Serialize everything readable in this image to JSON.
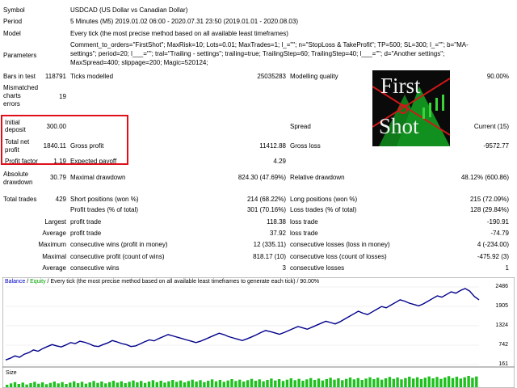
{
  "report": {
    "symbol_label": "Symbol",
    "symbol_value": "USDCAD (US Dollar vs Canadian Dollar)",
    "period_label": "Period",
    "period_value": "5 Minutes (M5) 2019.01.02 06:00 - 2020.07.31 23:50 (2019.01.01 - 2020.08.03)",
    "model_label": "Model",
    "model_value": "Every tick (the most precise method based on all available least timeframes)",
    "parameters_label": "Parameters",
    "parameters_line1": "Comment_to_orders=\"FirstShot\"; MaxRisk=10; Lots=0.01; MaxTrades=1; l_=\"\"; n=\"StopLoss & TakeProfit\"; TP=500; SL=300; l_=\"\"; b=\"MA-",
    "parameters_line2": "settings\"; period=20; l___=\"\"; tral=\"Trailing - settings\"; trailing=true; TrailingStep=60; TrailingStep=40; l___=\"\"; d=\"Another settings\";",
    "parameters_line3": "MaxSpread=400; slippage=200; Magic=520124;",
    "bars_label": "Bars in test",
    "bars_value": "118791",
    "ticks_label": "Ticks modelled",
    "ticks_value": "25035283",
    "quality_label": "Modelling quality",
    "quality_value": "90.00%",
    "mismatched_label_1": "Mismatched",
    "mismatched_label_2": "charts",
    "mismatched_label_3": "errors",
    "mismatched_value": "19",
    "initial_label_1": "Initial",
    "initial_label_2": "deposit",
    "initial_value": "300.00",
    "spread_label": "Spread",
    "spread_value": "Current (15)",
    "net_label_1": "Total net",
    "net_label_2": "profit",
    "net_value": "1840.11",
    "gross_profit_label": "Gross profit",
    "gross_profit_value": "11412.88",
    "gross_loss_label": "Gross loss",
    "gross_loss_value": "-9572.77",
    "pf_label": "Profit factor",
    "pf_value": "1.19",
    "ep_label": "Expected payoff",
    "ep_value": "4.29",
    "abs_dd_label_1": "Absolute",
    "abs_dd_label_2": "drawdown",
    "abs_dd_value": "30.79",
    "max_dd_label": "Maximal drawdown",
    "max_dd_value": "824.30 (47.69%)",
    "rel_dd_label": "Relative drawdown",
    "rel_dd_value": "48.12% (600.86)",
    "total_trades_label": "Total trades",
    "total_trades_value": "429",
    "short_label": "Short positions (won %)",
    "short_value": "214 (68.22%)",
    "long_label": "Long positions (won %)",
    "long_value": "215 (72.09%)",
    "profit_trades_label": "Profit trades (% of total)",
    "profit_trades_value": "301 (70.16%)",
    "loss_trades_label": "Loss trades (% of total)",
    "loss_trades_value": "128 (29.84%)",
    "largest_label": "Largest",
    "largest_profit_label": "profit trade",
    "largest_profit_value": "118.38",
    "largest_loss_label": "loss trade",
    "largest_loss_value": "-190.91",
    "average_label": "Average",
    "average_profit_label": "profit trade",
    "average_profit_value": "37.92",
    "average_loss_label": "loss trade",
    "average_loss_value": "-74.79",
    "maximum_label": "Maximum",
    "max_cons_wins_label": "consecutive wins (profit in money)",
    "max_cons_wins_value": "12 (335.11)",
    "max_cons_losses_label": "consecutive losses (loss in money)",
    "max_cons_losses_value": "4 (-234.00)",
    "maximal_label": "Maximal",
    "maximal_wins_label": "consecutive profit (count of wins)",
    "maximal_wins_value": "818.17 (10)",
    "maximal_losses_label": "consecutive loss (count of losses)",
    "maximal_losses_value": "-475.92 (3)",
    "average2_label": "Average",
    "avg_cons_wins_label": "consecutive wins",
    "avg_cons_wins_value": "3",
    "avg_cons_losses_label": "consecutive losses",
    "avg_cons_losses_value": "1"
  },
  "logo": {
    "line1": "First",
    "line2": "Shot"
  },
  "chart_legend": {
    "balance": "Balance",
    "sep1": " / ",
    "equity": "Equity",
    "rest": " / Every tick (the most precise method based on all available least timeframes to generate each tick) / 90.00%",
    "balance_color": "#0000c8",
    "equity_color": "#00a000"
  },
  "size_label": "Size",
  "colors": {
    "highlight": "#e0101a",
    "balance_line": "#00008b",
    "volume": "#1fc01f"
  },
  "chart_data": {
    "type": "line",
    "title": "",
    "yticks": [
      161,
      742,
      1324,
      1905,
      2486
    ],
    "ylim": [
      161,
      2486
    ],
    "series": [
      {
        "name": "Balance",
        "values": [
          300,
          350,
          420,
          380,
          470,
          520,
          600,
          560,
          640,
          700,
          760,
          720,
          690,
          750,
          820,
          790,
          860,
          830,
          780,
          720,
          700,
          760,
          810,
          880,
          840,
          790,
          760,
          700,
          720,
          780,
          850,
          900,
          870,
          940,
          1000,
          1060,
          1020,
          980,
          940,
          900,
          860,
          820,
          860,
          920,
          980,
          1040,
          1100,
          1060,
          1000,
          960,
          920,
          880,
          930,
          990,
          1050,
          1120,
          1180,
          1150,
          1110,
          1070,
          1120,
          1180,
          1240,
          1300,
          1260,
          1220,
          1280,
          1340,
          1400,
          1460,
          1420,
          1380,
          1440,
          1520,
          1600,
          1680,
          1760,
          1700,
          1660,
          1740,
          1820,
          1900,
          1860,
          1940,
          2020,
          2100,
          2060,
          2000,
          1960,
          1920,
          1980,
          2060,
          2140,
          2220,
          2180,
          2260,
          2340,
          2300,
          2380,
          2440,
          2360,
          2200,
          2100
        ]
      }
    ],
    "volume": {
      "name": "Size",
      "n": 120
    }
  }
}
